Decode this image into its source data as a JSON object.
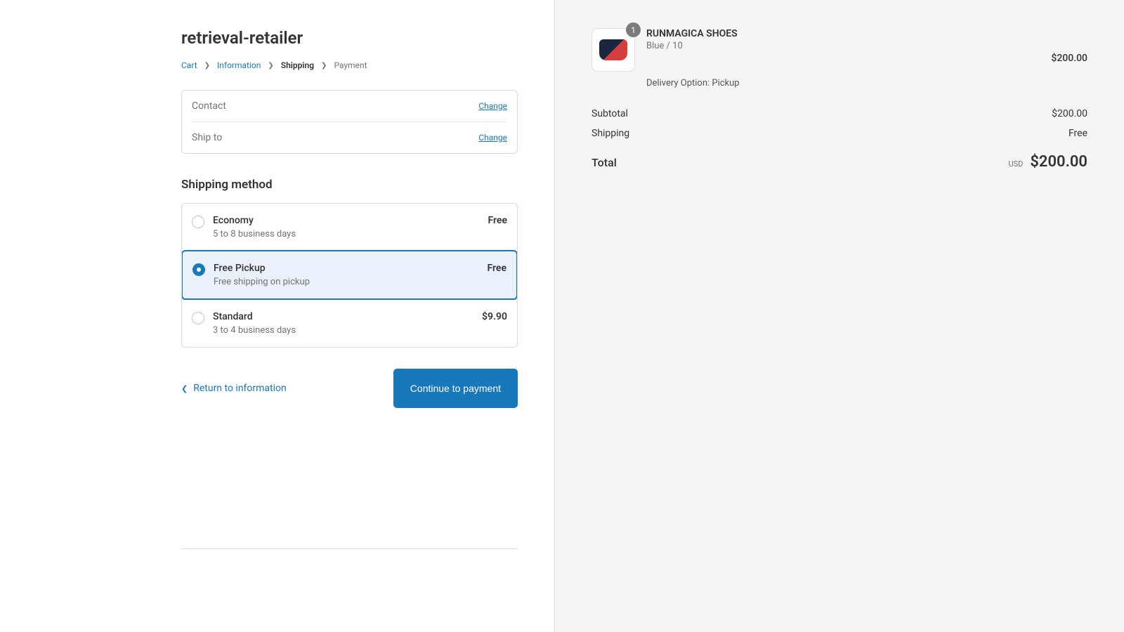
{
  "store": {
    "name": "retrieval-retailer"
  },
  "breadcrumb": {
    "cart": "Cart",
    "information": "Information",
    "shipping": "Shipping",
    "payment": "Payment"
  },
  "review": {
    "contact_label": "Contact",
    "contact_value": "",
    "shipto_label": "Ship to",
    "shipto_value": "",
    "change": "Change"
  },
  "shipping": {
    "heading": "Shipping method",
    "options": [
      {
        "name": "Economy",
        "desc": "5 to 8 business days",
        "price": "Free",
        "selected": false
      },
      {
        "name": "Free Pickup",
        "desc": "Free shipping on pickup",
        "price": "Free",
        "selected": true
      },
      {
        "name": "Standard",
        "desc": "3 to 4 business days",
        "price": "$9.90",
        "selected": false
      }
    ]
  },
  "actions": {
    "return": "Return to information",
    "continue": "Continue to payment"
  },
  "cart": {
    "item": {
      "qty": "1",
      "name": "RUNMAGICA SHOES",
      "variant": "Blue / 10",
      "delivery": "Delivery Option: Pickup",
      "price": "$200.00"
    },
    "subtotal_label": "Subtotal",
    "subtotal": "$200.00",
    "shipping_label": "Shipping",
    "shipping": "Free",
    "total_label": "Total",
    "currency": "USD",
    "total": "$200.00"
  }
}
